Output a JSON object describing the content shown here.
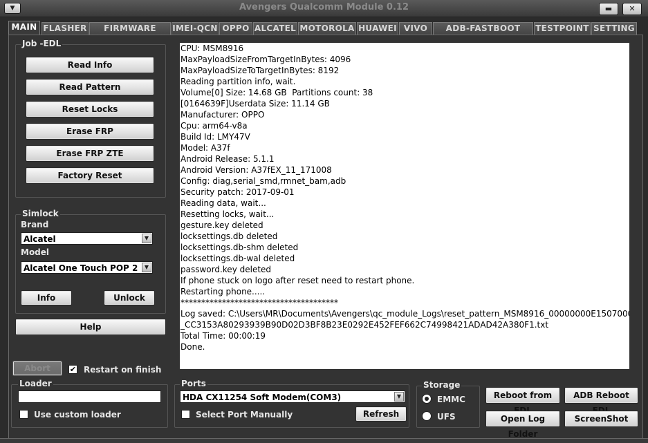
{
  "window": {
    "title": "Avengers Qualcomm Module 0.12",
    "sysmenu_label": "▼",
    "minimize_label": "▬",
    "close_label": "✕"
  },
  "tabs": [
    "MAIN",
    "FLASHER",
    "FIRMWARE UTILS",
    "IMEI-QCN",
    "OPPO",
    "ALCATEL",
    "MOTOROLA",
    "HUAWEI",
    "VIVO",
    "ADB-FASTBOOT UTILS",
    "TESTPOINT",
    "SETTING"
  ],
  "job": {
    "label": "Job -EDL",
    "buttons": [
      "Read Info",
      "Read Pattern",
      "Reset Locks",
      "Erase FRP",
      "Erase FRP ZTE",
      "Factory Reset"
    ]
  },
  "simlock": {
    "label": "Simlock",
    "brand_label": "Brand",
    "brand_value": "Alcatel",
    "model_label": "Model",
    "model_value": "Alcatel One Touch POP 2",
    "info_button": "Info",
    "unlock_button": "Unlock"
  },
  "help_button": "Help",
  "abort_button": "Abort",
  "restart_on_finish": {
    "label": "Restart on finish",
    "checked": true,
    "mark": "✔"
  },
  "loader": {
    "label": "Loader",
    "value": "",
    "use_custom_label": "Use custom loader"
  },
  "ports": {
    "label": "Ports",
    "value": "HDA CX11254 Soft Modem(COM3)",
    "select_manually_label": "Select Port Manually",
    "refresh_button": "Refresh"
  },
  "storage": {
    "label": "Storage",
    "options": [
      "EMMC",
      "UFS"
    ],
    "selected": "EMMC"
  },
  "actions": {
    "reboot_edl": "Reboot from EDL",
    "adb_reboot_edl": "ADB Reboot EDL",
    "open_log_folder": "Open Log Folder",
    "screenshot": "ScreenShot"
  },
  "log": [
    "CPU: MSM8916",
    "MaxPayloadSizeFromTargetInBytes: 4096",
    "MaxPayloadSizeToTargetInBytes: 8192",
    "Reading partition info, wait.",
    "Volume[0] Size: 14.68 GB  Partitions count: 38",
    "[0164639F]Userdata Size: 11.14 GB",
    "Manufacturer: OPPO",
    "Cpu: arm64-v8a",
    "Build Id: LMY47V",
    "Model: A37f",
    "Android Release: 5.1.1",
    "Android Version: A37fEX_11_171008",
    "Config: diag,serial_smd,rmnet_bam,adb",
    "Security patch: 2017-09-01",
    "Reading data, wait...",
    "Resetting locks, wait...",
    "gesture.key deleted",
    "locksettings.db deleted",
    "locksettings.db-shm deleted",
    "locksettings.db-wal deleted",
    "password.key deleted",
    "If phone stuck on logo after reset need to restart phone.",
    "Restarting phone.....",
    "**************************************",
    "Log saved: C:\\Users\\MR\\Documents\\Avengers\\qc_module_Logs\\reset_pattern_MSM8916_00000000E1507000",
    "_CC3153A80293939B90D02D3BF8B23E0292E452FEF662C74998421ADAD42A380F1.txt",
    "Total Time: 00:00:19",
    "Done."
  ]
}
